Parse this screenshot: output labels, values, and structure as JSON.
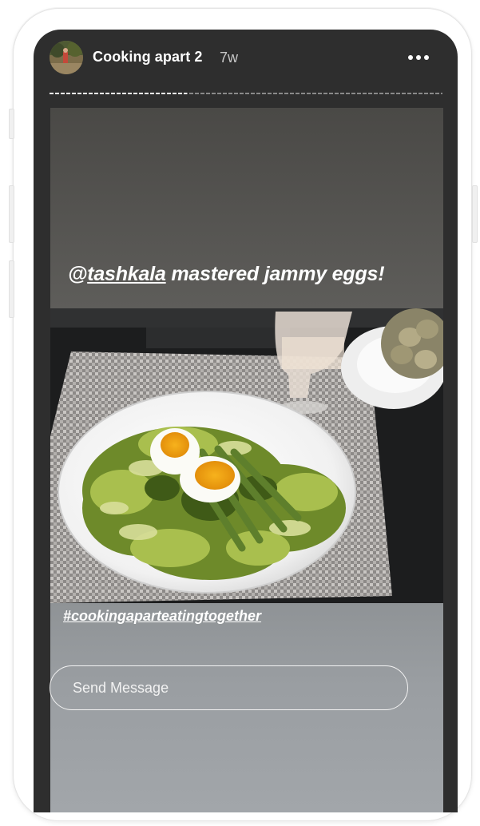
{
  "story": {
    "username": "Cooking apart 2",
    "time": "7w",
    "progress_fraction": 0.35,
    "caption_prefix": "@",
    "caption_mention": "tashkala",
    "caption_rest": " mastered jammy eggs!",
    "hashtag": "#cookingaparteatingtogether",
    "reply_placeholder": "Send Message"
  },
  "icons": {
    "more": "more-horizontal-icon",
    "avatar": "profile-avatar"
  }
}
